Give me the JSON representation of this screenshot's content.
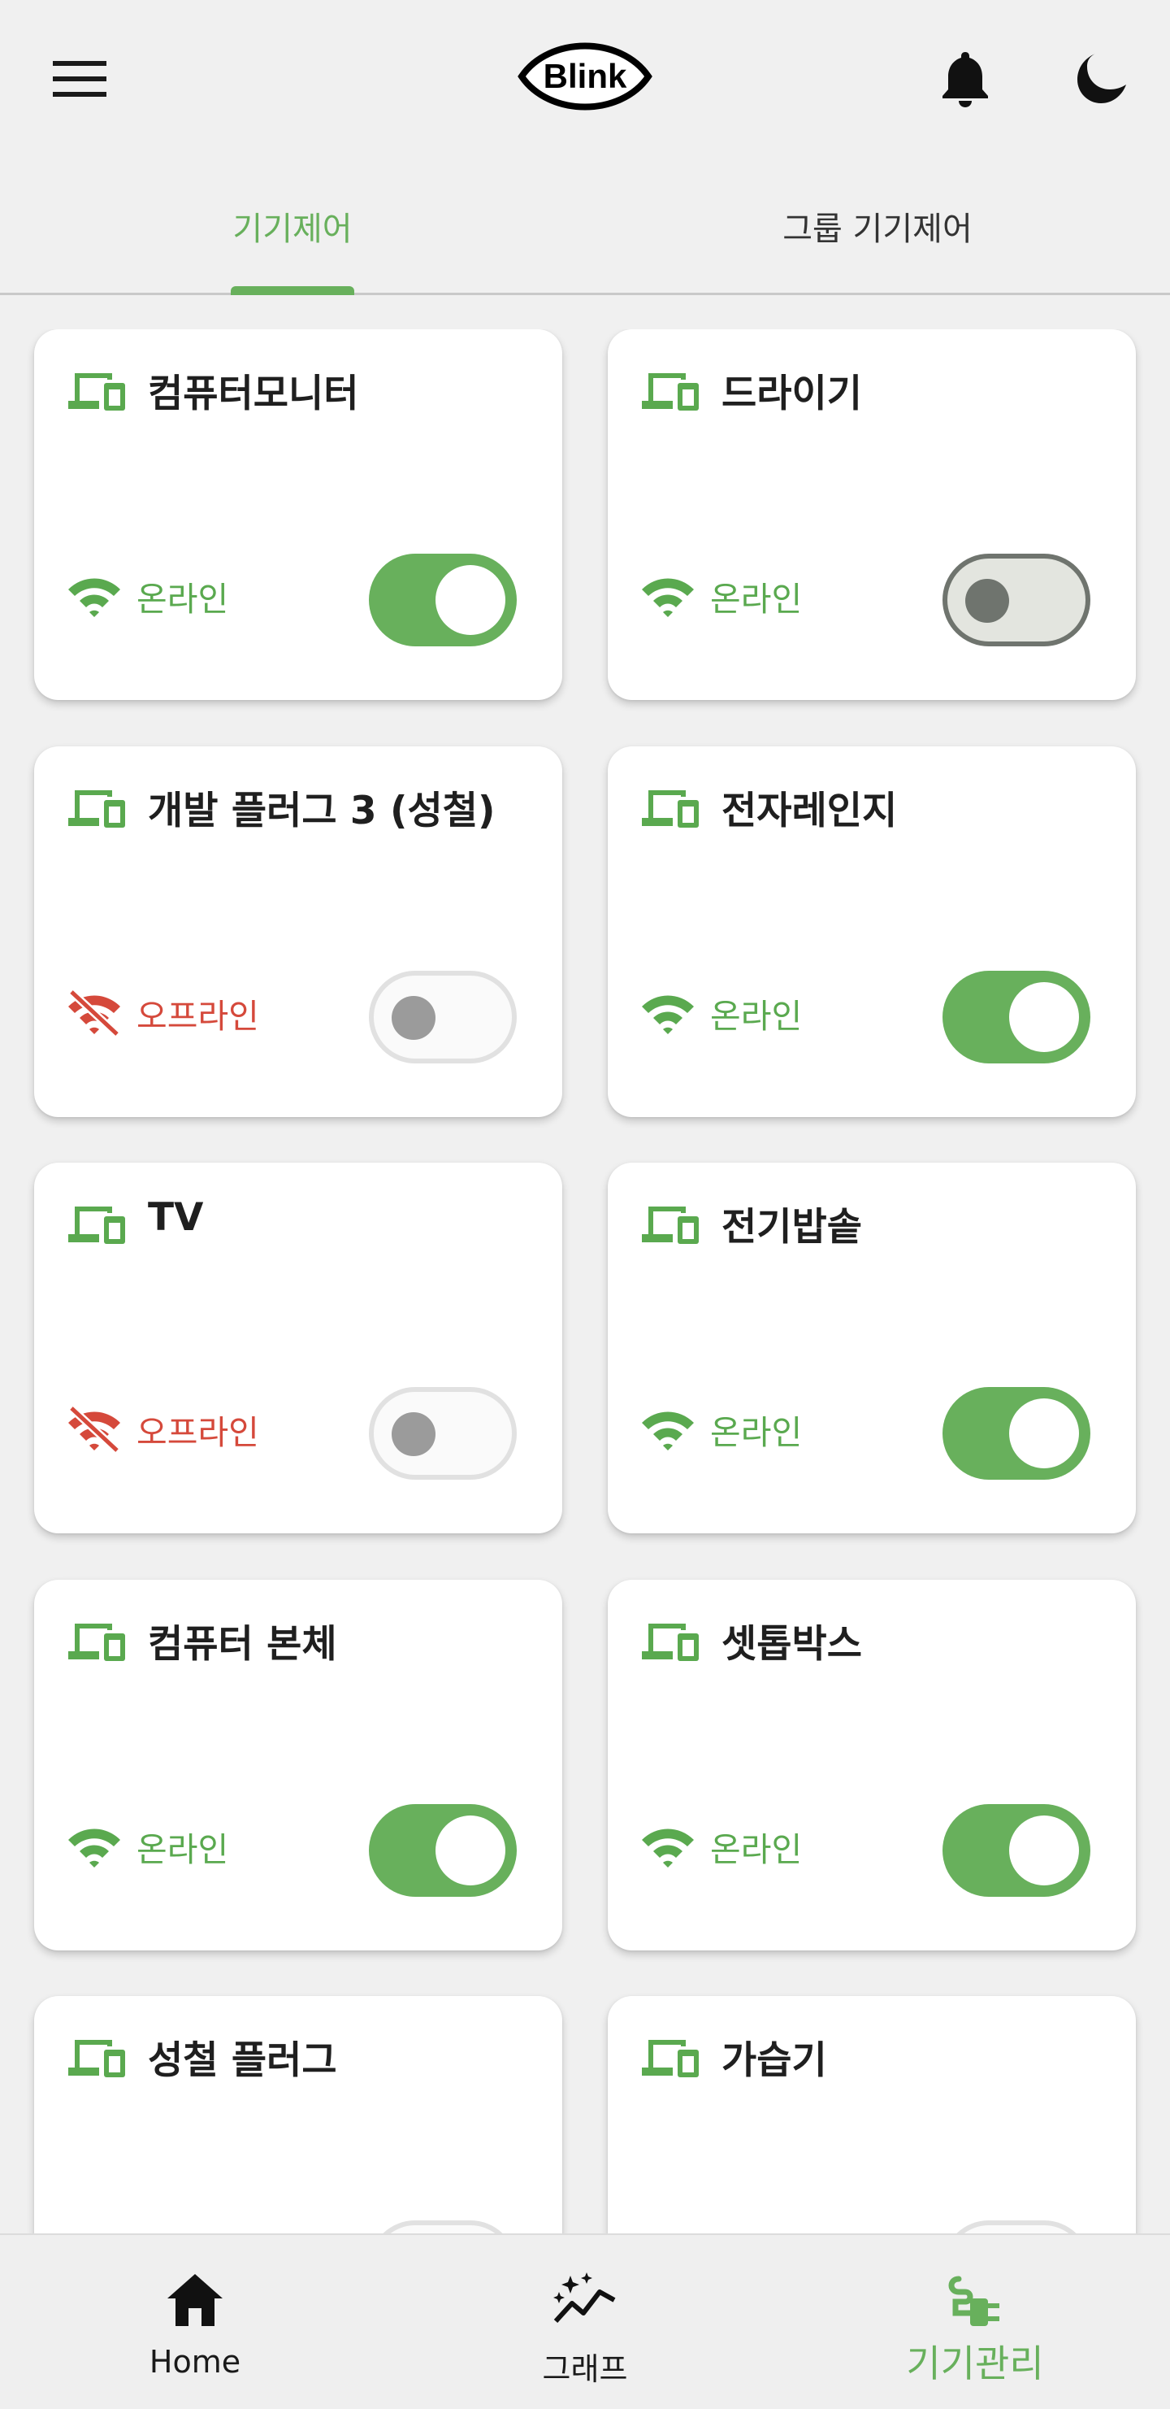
{
  "app": {
    "logo_text": "Blink",
    "accent_color": "#68b05c"
  },
  "header": {
    "icons": [
      "menu-icon",
      "bell-icon",
      "moon-icon"
    ]
  },
  "tabs": [
    {
      "label": "기기제어",
      "active": true
    },
    {
      "label": "그룹 기기제어",
      "active": false
    }
  ],
  "devices": [
    {
      "name": "컴퓨터모니터",
      "status": "온라인",
      "online": true,
      "switch": "on"
    },
    {
      "name": "드라이기",
      "status": "온라인",
      "online": true,
      "switch": "off"
    },
    {
      "name": "개발 플러그 3 (성철)",
      "status": "오프라인",
      "online": false,
      "switch": "disabled"
    },
    {
      "name": "전자레인지",
      "status": "온라인",
      "online": true,
      "switch": "on"
    },
    {
      "name": "TV",
      "status": "오프라인",
      "online": false,
      "switch": "disabled"
    },
    {
      "name": "전기밥솥",
      "status": "온라인",
      "online": true,
      "switch": "on"
    },
    {
      "name": "컴퓨터 본체",
      "status": "온라인",
      "online": true,
      "switch": "on"
    },
    {
      "name": "셋톱박스",
      "status": "온라인",
      "online": true,
      "switch": "on"
    },
    {
      "name": "성철 플러그",
      "status": "",
      "online": true,
      "switch": "disabled"
    },
    {
      "name": "가습기",
      "status": "",
      "online": true,
      "switch": "disabled"
    }
  ],
  "colors": {
    "online": "#5aa94f",
    "offline": "#d5493b",
    "switch_on": "#68b05c"
  },
  "bottom_nav": [
    {
      "label": "Home",
      "icon": "home-icon",
      "active": false
    },
    {
      "label": "그래프",
      "icon": "graph-icon",
      "active": false
    },
    {
      "label": "기기관리",
      "icon": "plug-icon",
      "active": true
    }
  ]
}
